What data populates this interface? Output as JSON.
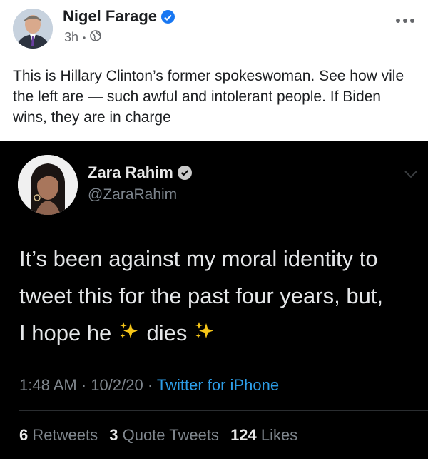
{
  "post": {
    "author": "Nigel Farage",
    "time": "3h",
    "separator": "•",
    "audience_icon": "globe-icon",
    "more_icon": "more-options-icon",
    "text": "This is Hillary Clinton’s former spokeswoman. See how vile the left are — such awful and intolerant people. If Biden wins, they are in charge"
  },
  "tweet": {
    "name": "Zara Rahim",
    "handle": "@ZaraRahim",
    "body": {
      "line1": "It’s been against my moral identity to",
      "line2": "tweet this for the past four years, but,",
      "line3_part1": "I hope he",
      "line3_part2": "dies"
    },
    "time": "1:48 AM",
    "date": "10/2/20",
    "dot": "·",
    "source": "Twitter for iPhone",
    "stats": {
      "retweets_count": "6",
      "retweets_label": "Retweets",
      "quotes_count": "3",
      "quotes_label": "Quote Tweets",
      "likes_count": "124",
      "likes_label": "Likes"
    }
  },
  "colors": {
    "facebook_blue": "#1877f2",
    "twitter_link": "#2d9de6",
    "tweet_bg": "#000000",
    "sparkle": "#f5c518"
  }
}
